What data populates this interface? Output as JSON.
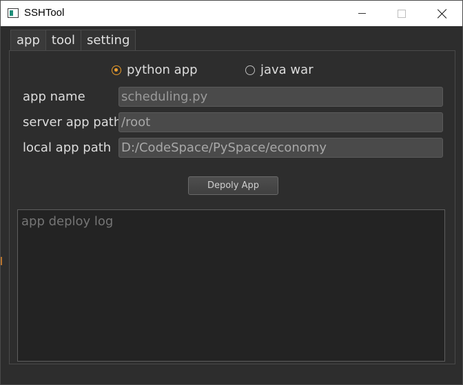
{
  "window": {
    "title": "SSHTool",
    "controls": {
      "minimize": "minimize-icon",
      "maximize": "maximize-icon",
      "close": "close-icon"
    }
  },
  "tabs": [
    {
      "label": "app",
      "active": true
    },
    {
      "label": "tool",
      "active": false
    },
    {
      "label": "setting",
      "active": false
    }
  ],
  "app_type": {
    "options": [
      {
        "label": "python app",
        "checked": true
      },
      {
        "label": "java war",
        "checked": false
      }
    ]
  },
  "form": {
    "app_name": {
      "label": "app name",
      "value": "scheduling.py"
    },
    "server_app_path": {
      "label": "server app path",
      "value": "/root"
    },
    "local_app_path": {
      "label": "local app path",
      "value": "D:/CodeSpace/PySpace/economy"
    }
  },
  "deploy_button": {
    "label": "Depoly App"
  },
  "log": {
    "placeholder": "app deploy log",
    "value": ""
  },
  "colors": {
    "accent": "#f0a030",
    "background": "#2d2d2d",
    "field_bg": "#4a4a4a",
    "log_bg": "#232323"
  }
}
